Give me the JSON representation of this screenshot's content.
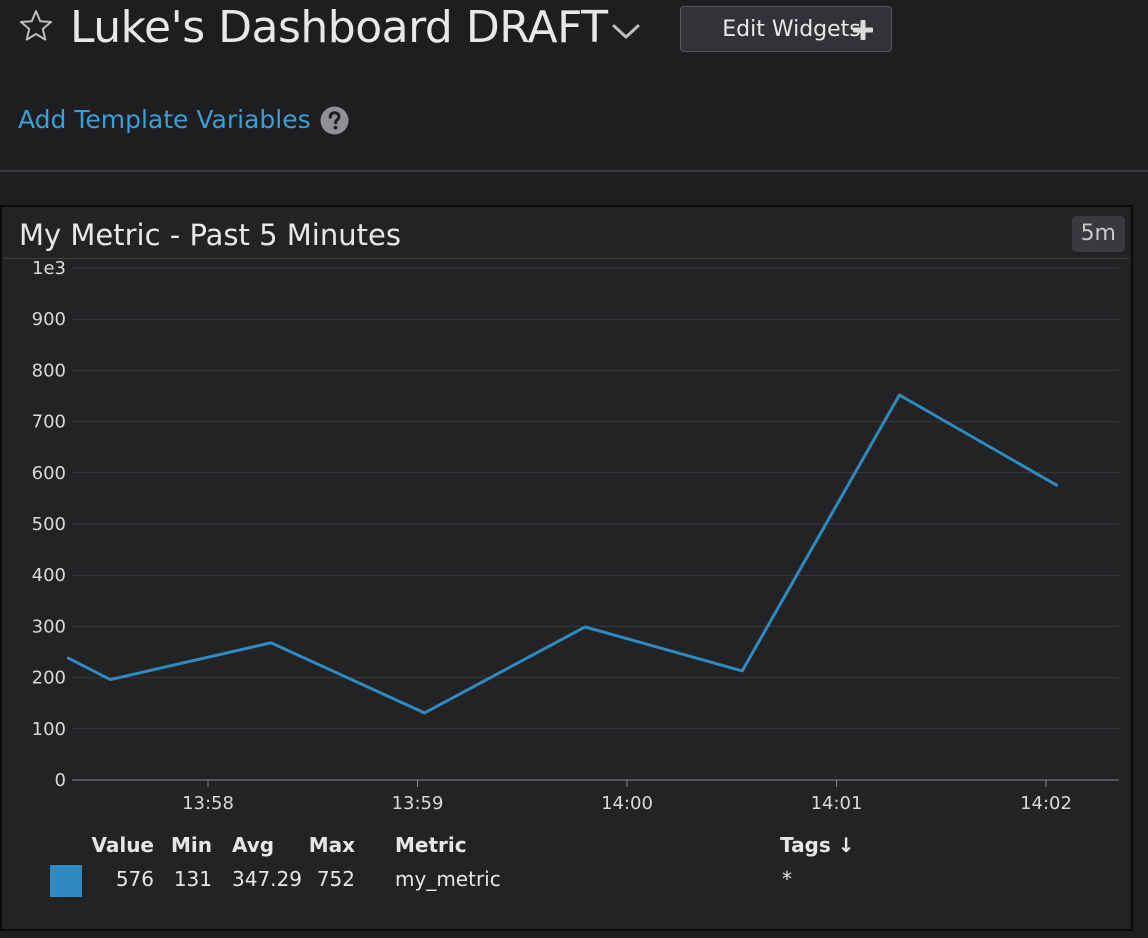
{
  "header": {
    "title": "Luke's Dashboard DRAFT",
    "edit_widgets_label": "Edit Widgets",
    "template_link": "Add Template Variables"
  },
  "widget": {
    "title": "My Metric - Past 5 Minutes",
    "timeframe": "5m"
  },
  "colors": {
    "background": "#1e1e21",
    "widget_background": "#232326",
    "series_line": "#2e8bc0",
    "link": "#3a9fd6",
    "gridline": "#3a3a3e"
  },
  "icons": [
    "star-icon",
    "chevron-down-icon",
    "plus-icon",
    "help-icon"
  ],
  "chart_data": {
    "type": "line",
    "title": "",
    "xlabel": "",
    "ylabel": "",
    "ylim": [
      0,
      1000
    ],
    "grid": true,
    "y_ticks": [
      "0",
      "100",
      "200",
      "300",
      "400",
      "500",
      "600",
      "700",
      "800",
      "900",
      "1e3"
    ],
    "x_ticks": [
      "13:58",
      "13:59",
      "14:00",
      "14:01",
      "14:02"
    ],
    "series": [
      {
        "x": [
          "13:57:20",
          "13:57:32",
          "13:58:18",
          "13:59:02",
          "13:59:48",
          "14:00:33",
          "14:01:18",
          "14:02:03"
        ],
        "values": [
          238,
          196,
          268,
          131,
          299,
          213,
          752,
          576
        ]
      }
    ]
  },
  "legend": {
    "headers": {
      "value": "Value",
      "min": "Min",
      "avg": "Avg",
      "max": "Max",
      "metric": "Metric",
      "tags": "Tags ↓"
    },
    "row": {
      "value": "576",
      "min": "131",
      "avg": "347.29",
      "max": "752",
      "metric": "my_metric",
      "tags": "*"
    }
  }
}
